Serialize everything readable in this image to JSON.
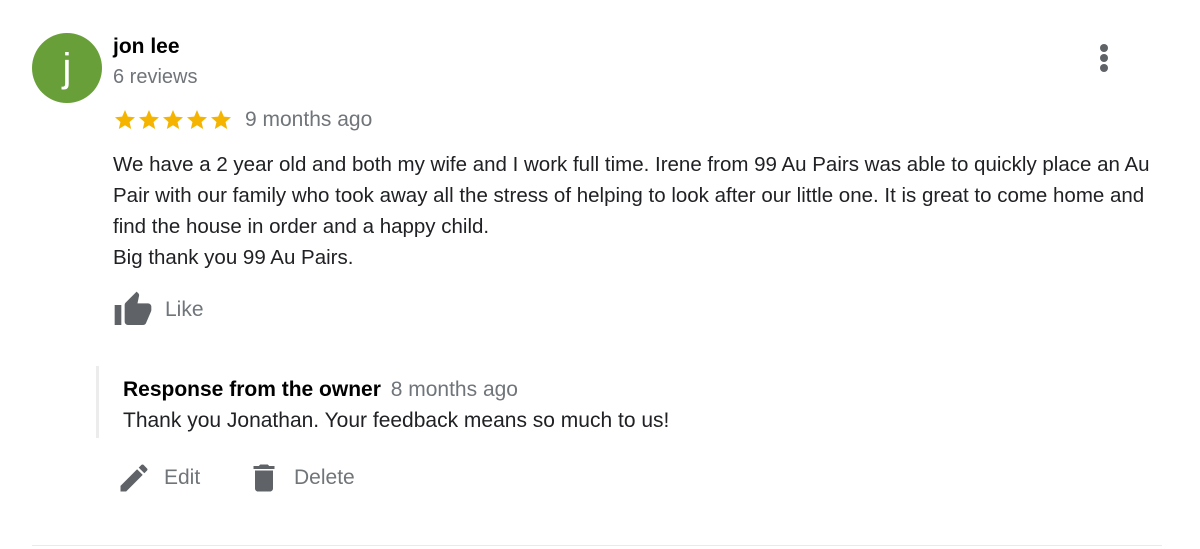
{
  "review": {
    "reviewer": {
      "avatar_initial": "j",
      "name": "jon lee",
      "review_count": "6 reviews"
    },
    "more_icon": "more-vertical-icon",
    "rating": {
      "stars": 5,
      "max_stars": 5,
      "star_color": "#f4b400",
      "date": "9 months ago"
    },
    "text_lines": [
      "We have a 2 year old and both my wife and I work full time. Irene from 99 Au Pairs was able to quickly place an Au Pair with our family who took away all the stress of helping to look after our little one. It is great to come home and find the house in order and a happy child.",
      "Big thank you 99 Au Pairs."
    ],
    "like": {
      "icon": "thumbs-up-icon",
      "label": "Like"
    }
  },
  "owner_response": {
    "title": "Response from the owner",
    "date": "8 months ago",
    "text": "Thank you Jonathan. Your feedback means so much to us!"
  },
  "actions": {
    "edit": {
      "icon": "pencil-icon",
      "label": "Edit"
    },
    "delete": {
      "icon": "trash-icon",
      "label": "Delete"
    }
  },
  "colors": {
    "avatar_bg": "#689f38",
    "secondary_text": "#70757a",
    "icon_gray": "#5f6368"
  }
}
